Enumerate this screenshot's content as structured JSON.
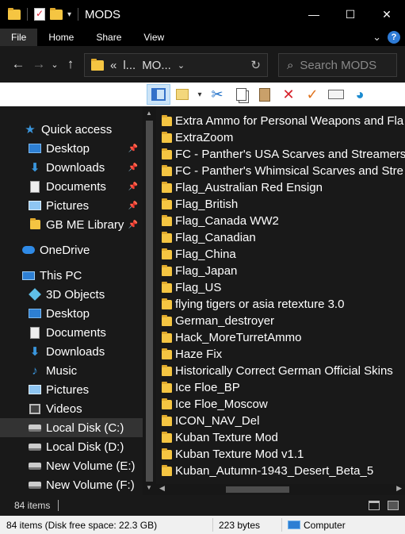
{
  "window": {
    "title": "MODS",
    "minimize": "—",
    "maximize": "☐",
    "close": "✕"
  },
  "ribbon": {
    "tabs": [
      "File",
      "Home",
      "Share",
      "View"
    ],
    "collapse_icon": "⌄",
    "help_icon": "?"
  },
  "address": {
    "back": "←",
    "forward": "→",
    "recent": "⌄",
    "up": "↑",
    "breadcrumb_overflow": "«",
    "breadcrumb_parent": "l...",
    "breadcrumb_current": "MO...",
    "breadcrumb_dropdown": "⌄",
    "refresh": "↻",
    "search_placeholder": "Search MODS"
  },
  "toolbar": {
    "icons": [
      "preview-pane-icon",
      "properties-icon",
      "cut-icon",
      "copy-icon",
      "paste-icon",
      "delete-icon",
      "select-all-icon",
      "rename-icon",
      "shell-icon"
    ],
    "dropdown": "▾"
  },
  "nav": {
    "quick_access": "Quick access",
    "items": [
      {
        "label": "Desktop",
        "icon": "desktop-icon",
        "pinned": true
      },
      {
        "label": "Downloads",
        "icon": "downloads-icon",
        "pinned": true
      },
      {
        "label": "Documents",
        "icon": "documents-icon",
        "pinned": true
      },
      {
        "label": "Pictures",
        "icon": "pictures-icon",
        "pinned": true
      },
      {
        "label": "GB ME Library",
        "icon": "folder-icon",
        "pinned": true
      }
    ],
    "onedrive": "OneDrive",
    "this_pc": "This PC",
    "pc_items": [
      {
        "label": "3D Objects",
        "icon": "3d-objects-icon"
      },
      {
        "label": "Desktop",
        "icon": "desktop-icon"
      },
      {
        "label": "Documents",
        "icon": "documents-icon"
      },
      {
        "label": "Downloads",
        "icon": "downloads-icon"
      },
      {
        "label": "Music",
        "icon": "music-icon"
      },
      {
        "label": "Pictures",
        "icon": "pictures-icon"
      },
      {
        "label": "Videos",
        "icon": "videos-icon"
      },
      {
        "label": "Local Disk (C:)",
        "icon": "disk-icon",
        "selected": true
      },
      {
        "label": "Local Disk (D:)",
        "icon": "disk-icon"
      },
      {
        "label": "New Volume (E:)",
        "icon": "disk-icon"
      },
      {
        "label": "New Volume (F:)",
        "icon": "disk-icon"
      }
    ]
  },
  "files": [
    "Extra Ammo for Personal Weapons and Fla",
    "ExtraZoom",
    "FC - Panther's USA Scarves and Streamers",
    "FC - Panther's Whimsical Scarves and Stre",
    "Flag_Australian Red Ensign",
    "Flag_British",
    "Flag_Canada WW2",
    "Flag_Canadian",
    "Flag_China",
    "Flag_Japan",
    "Flag_US",
    "flying tigers or asia retexture 3.0",
    "German_destroyer",
    "Hack_MoreTurretAmmo",
    "Haze Fix",
    "Historically Correct German Official Skins",
    "Ice Floe_BP",
    "Ice Floe_Moscow",
    "ICON_NAV_Del",
    "Kuban Texture Mod",
    "Kuban Texture Mod v1.1",
    "Kuban_Autumn-1943_Desert_Beta_5"
  ],
  "footer": {
    "item_count": "84 items"
  },
  "status": {
    "left": "84 items (Disk free space: 22.3 GB)",
    "size": "223 bytes",
    "location": "Computer"
  },
  "colors": {
    "folder": "#f5c542",
    "accent": "#3a96dd",
    "background": "#191919"
  }
}
